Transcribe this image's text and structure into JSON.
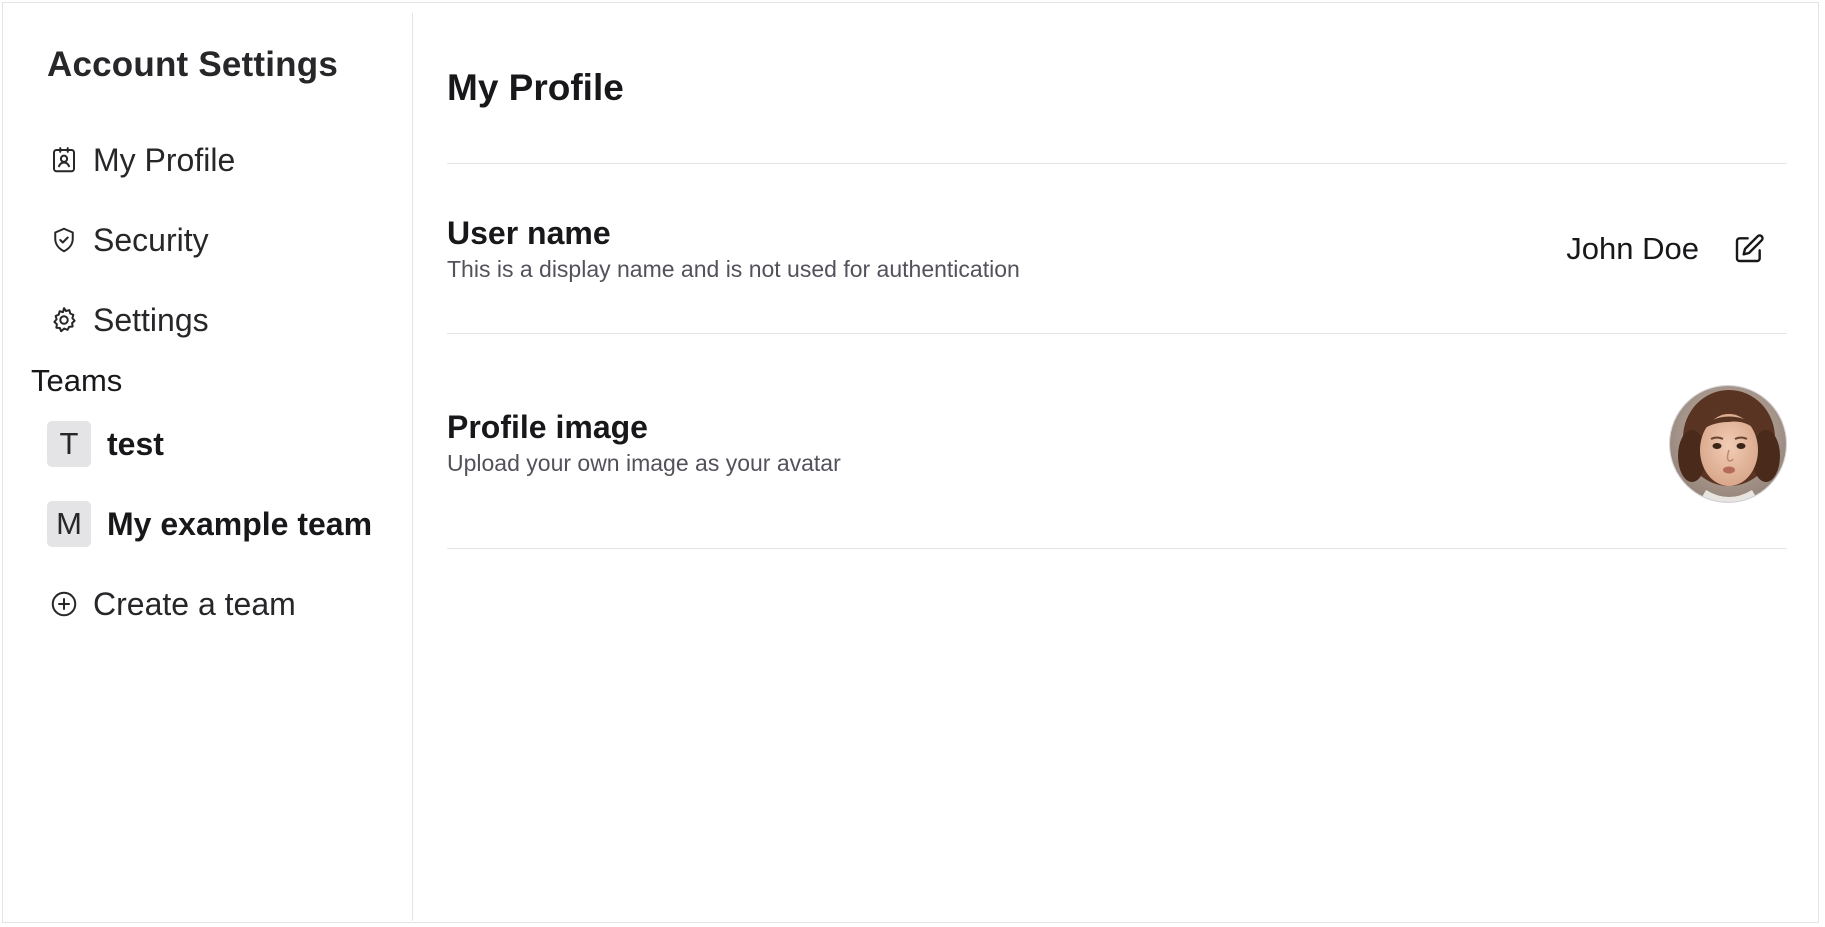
{
  "sidebar": {
    "title": "Account Settings",
    "nav": [
      {
        "label": "My Profile",
        "icon": "profile-badge-icon"
      },
      {
        "label": "Security",
        "icon": "shield-check-icon"
      },
      {
        "label": "Settings",
        "icon": "gear-icon"
      }
    ],
    "teams_label": "Teams",
    "teams": [
      {
        "initial": "T",
        "name": "test"
      },
      {
        "initial": "M",
        "name": "My example team"
      }
    ],
    "create_team": {
      "label": "Create a team",
      "icon": "plus-circle-icon"
    }
  },
  "main": {
    "title": "My Profile",
    "username": {
      "title": "User name",
      "description": "This is a display name and is not used for authentication",
      "value": "John Doe",
      "edit_icon": "edit-icon"
    },
    "profile_image": {
      "title": "Profile image",
      "description": "Upload your own image as your avatar",
      "icon": "avatar-image"
    }
  },
  "colors": {
    "border": "#e4e4e7",
    "text": "#18181b",
    "muted_text": "#52525b",
    "badge_bg": "#e4e4e7"
  }
}
